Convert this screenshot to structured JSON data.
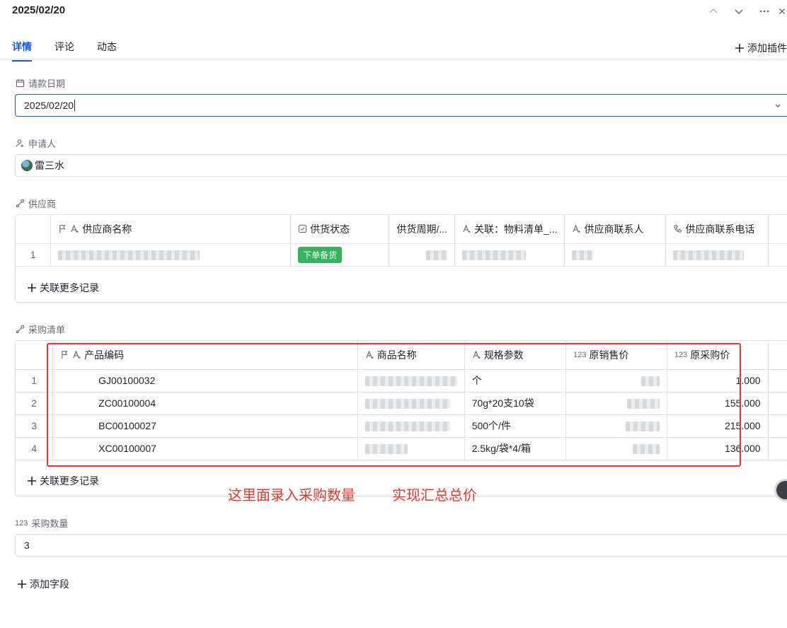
{
  "header": {
    "title": "2025/02/20"
  },
  "tabs": [
    {
      "label": "详情"
    },
    {
      "label": "评论"
    },
    {
      "label": "动态"
    }
  ],
  "plugin_label": "添加插件",
  "fields": {
    "date": {
      "label": "请款日期",
      "value": "2025/02/20"
    },
    "applicant": {
      "label": "申请人",
      "value": "雷三水"
    },
    "supplier": {
      "label": "供应商"
    },
    "purchase": {
      "label": "采购清单"
    },
    "qty": {
      "label": "采购数量",
      "value": "3"
    }
  },
  "supplier_table": {
    "columns": [
      "供应商名称",
      "供货状态",
      "供货周期/...",
      "关联：物料清单_...",
      "供应商联系人",
      "供应商联系电话"
    ],
    "rows": [
      {
        "index": "1",
        "status": "下单备货"
      }
    ],
    "add_more": "关联更多记录"
  },
  "purchase_table": {
    "columns": [
      "产品编码",
      "商品名称",
      "规格参数",
      "原销售价",
      "原采购价"
    ],
    "rows": [
      {
        "index": "1",
        "code": "GJ00100032",
        "spec": "个",
        "purchase_price": "1.000"
      },
      {
        "index": "2",
        "code": "ZC00100004",
        "spec": "70g*20支10袋",
        "purchase_price": "155.000"
      },
      {
        "index": "3",
        "code": "BC00100027",
        "spec": "500个/件",
        "purchase_price": "215.000"
      },
      {
        "index": "4",
        "code": "XC00100007",
        "spec": "2.5kg/袋*4/箱",
        "purchase_price": "136.000"
      }
    ],
    "add_more": "关联更多记录"
  },
  "annotations": {
    "left": "这里面录入采购数量",
    "right": "实现汇总总价"
  },
  "add_field": "添加字段",
  "colors": {
    "accent": "#1456f0",
    "tag_green": "#34b45a",
    "annotation_red": "#e8362d"
  }
}
